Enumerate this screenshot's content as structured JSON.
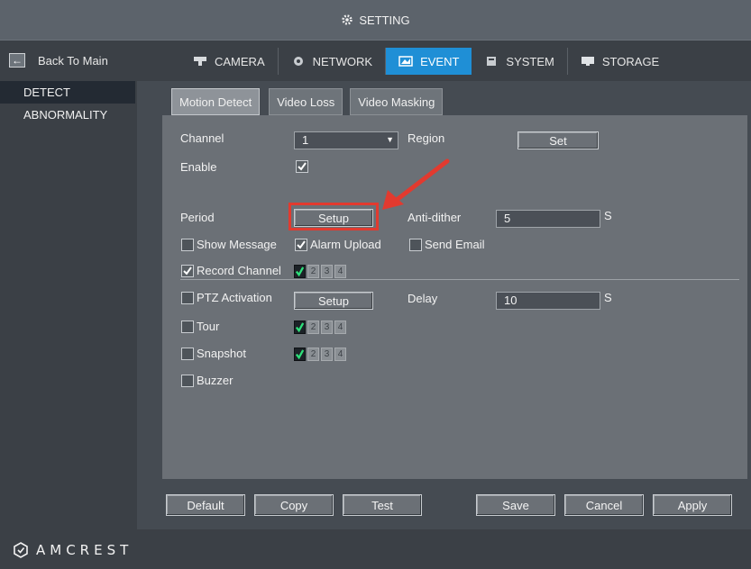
{
  "title": "SETTING",
  "nav": {
    "back_label": "Back To Main",
    "tabs": [
      {
        "label": "CAMERA",
        "icon": "camera-icon",
        "active": false
      },
      {
        "label": "NETWORK",
        "icon": "network-icon",
        "active": false
      },
      {
        "label": "EVENT",
        "icon": "event-icon",
        "active": true
      },
      {
        "label": "SYSTEM",
        "icon": "system-icon",
        "active": false
      },
      {
        "label": "STORAGE",
        "icon": "storage-icon",
        "active": false
      }
    ]
  },
  "sidebar": {
    "items": [
      {
        "label": "DETECT",
        "active": true
      },
      {
        "label": "ABNORMALITY",
        "active": false
      }
    ]
  },
  "subtabs": [
    {
      "label": "Motion Detect",
      "active": true
    },
    {
      "label": "Video Loss",
      "active": false
    },
    {
      "label": "Video Masking",
      "active": false
    }
  ],
  "form": {
    "channel_label": "Channel",
    "channel_value": "1",
    "region_label": "Region",
    "region_button": "Set",
    "enable_label": "Enable",
    "enable_checked": true,
    "period_label": "Period",
    "period_button": "Setup",
    "antidither_label": "Anti-dither",
    "antidither_value": "5",
    "antidither_unit": "S",
    "show_message_label": "Show Message",
    "show_message_checked": false,
    "alarm_upload_label": "Alarm Upload",
    "alarm_upload_checked": true,
    "send_email_label": "Send Email",
    "send_email_checked": false,
    "record_channel_label": "Record Channel",
    "record_channel_checked": true,
    "record_channels": [
      {
        "n": "1",
        "on": true
      },
      {
        "n": "2",
        "on": false
      },
      {
        "n": "3",
        "on": false
      },
      {
        "n": "4",
        "on": false
      }
    ],
    "ptz_label": "PTZ Activation",
    "ptz_checked": false,
    "ptz_button": "Setup",
    "delay_label": "Delay",
    "delay_value": "10",
    "delay_unit": "S",
    "tour_label": "Tour",
    "tour_checked": false,
    "tour_channels": [
      {
        "n": "1",
        "on": true
      },
      {
        "n": "2",
        "on": false
      },
      {
        "n": "3",
        "on": false
      },
      {
        "n": "4",
        "on": false
      }
    ],
    "snapshot_label": "Snapshot",
    "snapshot_checked": false,
    "snapshot_channels": [
      {
        "n": "1",
        "on": true
      },
      {
        "n": "2",
        "on": false
      },
      {
        "n": "3",
        "on": false
      },
      {
        "n": "4",
        "on": false
      }
    ],
    "buzzer_label": "Buzzer",
    "buzzer_checked": false
  },
  "buttons": {
    "default": "Default",
    "copy": "Copy",
    "test": "Test",
    "save": "Save",
    "cancel": "Cancel",
    "apply": "Apply"
  },
  "brand": {
    "logo_text": "AMCREST"
  },
  "colors": {
    "accent": "#1f8fd6",
    "annotation": "#e23a2f"
  }
}
